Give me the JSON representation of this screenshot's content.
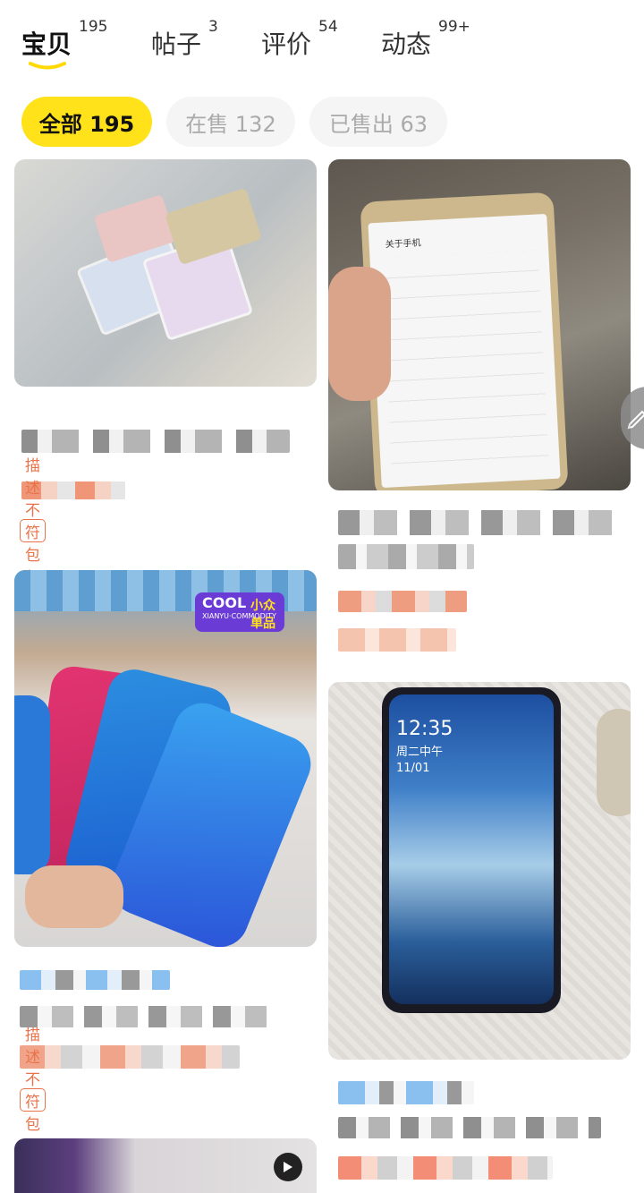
{
  "tabs": [
    {
      "label": "宝贝",
      "count": "195",
      "active": true
    },
    {
      "label": "帖子",
      "count": "3",
      "active": false
    },
    {
      "label": "评价",
      "count": "54",
      "active": false
    },
    {
      "label": "动态",
      "count": "99+",
      "active": false
    }
  ],
  "filters": [
    {
      "label": "全部 195",
      "active": true
    },
    {
      "label": "在售 132",
      "active": false
    },
    {
      "label": "已售出 63",
      "active": false
    }
  ],
  "items": [
    {
      "tag": "描述不符包邮退"
    },
    {
      "tag": ""
    },
    {
      "tag": "描述不符包邮退",
      "badge": {
        "line1": "COOL",
        "line2": "XIANYU·COMMODITY",
        "line3": "小众单品"
      }
    },
    {
      "tag": ""
    }
  ],
  "photo_texts": {
    "about_phone": "关于手机",
    "time": "12:35",
    "date": "周二中午 11/01"
  },
  "colors": {
    "accent_yellow": "#ffe21a",
    "tag_orange": "#e8734a",
    "pill_gray": "#f5f5f5"
  },
  "icons": {
    "play": "play-icon",
    "edit": "edit-icon"
  }
}
